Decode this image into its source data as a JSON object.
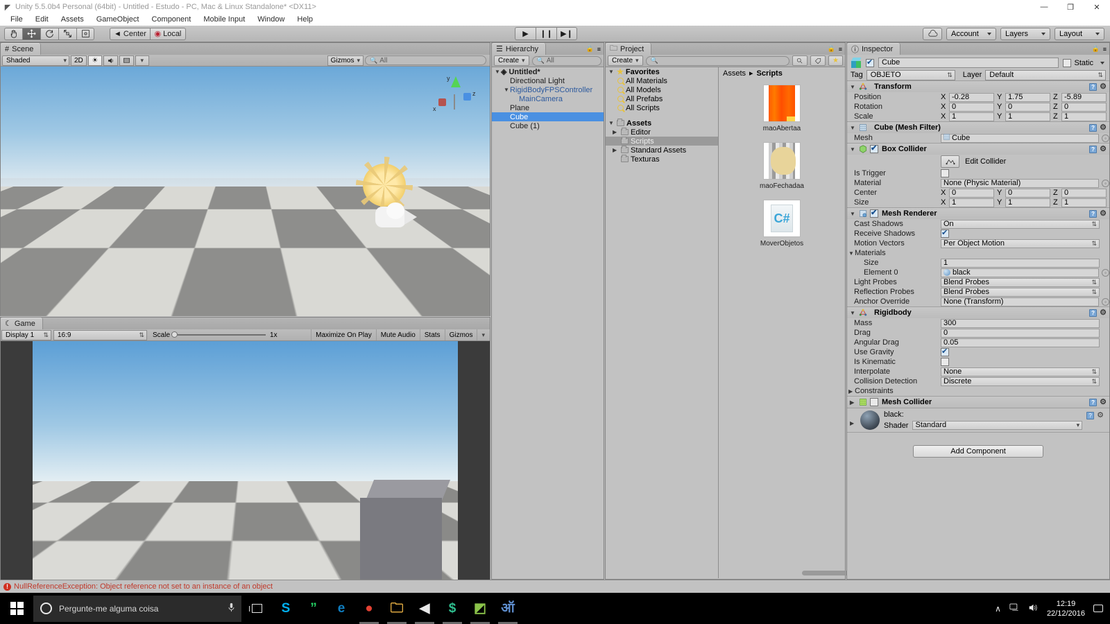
{
  "window": {
    "title": "Unity 5.5.0b4 Personal (64bit) - Untitled - Estudo - PC, Mac & Linux Standalone* <DX11>",
    "minimize": "—",
    "maximize": "❐",
    "close": "✕"
  },
  "menubar": {
    "items": [
      "File",
      "Edit",
      "Assets",
      "GameObject",
      "Component",
      "Mobile Input",
      "Window",
      "Help"
    ]
  },
  "toolbar": {
    "transform_tools": [
      {
        "name": "hand-tool",
        "glyph": "✋"
      },
      {
        "name": "move-tool",
        "glyph": "✛"
      },
      {
        "name": "rotate-tool",
        "glyph": "↻"
      },
      {
        "name": "scale-tool",
        "glyph": "⤡"
      },
      {
        "name": "rect-tool",
        "glyph": "▣"
      }
    ],
    "pivot_label": "Center",
    "rotation_label": "Local",
    "play": "▶",
    "pause": "❙❙",
    "step": "▶❙",
    "cloud": "☁",
    "account_label": "Account",
    "layers_label": "Layers",
    "layout_label": "Layout"
  },
  "scene": {
    "tab_title": "Scene",
    "shading_mode": "Shaded",
    "mode_2d": "2D",
    "lighting_icon": "☀",
    "audio_icon": "🔊",
    "fx_icon": "▣",
    "gizmos_label": "Gizmos",
    "search_placeholder": "All",
    "axis_labels": [
      "y",
      "z",
      "x"
    ]
  },
  "game": {
    "tab_title": "Game",
    "display": "Display 1",
    "aspect": "16:9",
    "scale_label": "Scale",
    "scale_value": "1x",
    "maximize_on_play": "Maximize On Play",
    "mute_audio": "Mute Audio",
    "stats": "Stats",
    "gizmos": "Gizmos"
  },
  "hierarchy": {
    "tab_title": "Hierarchy",
    "create_label": "Create",
    "search_placeholder": "All",
    "scene_name": "Untitled*",
    "items": [
      {
        "label": "Directional Light",
        "depth": 1,
        "expandable": false,
        "selected": false,
        "prefab": false
      },
      {
        "label": "RigidBodyFPSController",
        "depth": 1,
        "expandable": true,
        "selected": false,
        "prefab": true
      },
      {
        "label": "MainCamera",
        "depth": 2,
        "expandable": false,
        "selected": false,
        "prefab": true
      },
      {
        "label": "Plane",
        "depth": 1,
        "expandable": false,
        "selected": false,
        "prefab": false
      },
      {
        "label": "Cube",
        "depth": 1,
        "expandable": false,
        "selected": true,
        "prefab": false
      },
      {
        "label": "Cube (1)",
        "depth": 1,
        "expandable": false,
        "selected": false,
        "prefab": false
      }
    ]
  },
  "project": {
    "tab_title": "Project",
    "create_label": "Create",
    "search_placeholder": "",
    "favorites_label": "Favorites",
    "favorites": [
      "All Materials",
      "All Models",
      "All Prefabs",
      "All Scripts"
    ],
    "assets_label": "Assets",
    "folders": [
      {
        "label": "Editor",
        "expandable": true,
        "selected": false
      },
      {
        "label": "Scripts",
        "expandable": false,
        "selected": true
      },
      {
        "label": "Standard Assets",
        "expandable": true,
        "selected": false
      },
      {
        "label": "Texturas",
        "expandable": false,
        "selected": false
      }
    ],
    "breadcrumb": [
      "Assets",
      "Scripts"
    ],
    "assets": [
      {
        "name": "maoAbertaa",
        "kind": "texture-orange"
      },
      {
        "name": "maoFechadaa",
        "kind": "texture-hand"
      },
      {
        "name": "MoverObjetos",
        "kind": "csharp-script"
      }
    ]
  },
  "inspector": {
    "tab_title": "Inspector",
    "object_name": "Cube",
    "enabled": true,
    "static_label": "Static",
    "static_checked": false,
    "tag_label": "Tag",
    "tag_value": "OBJETO",
    "layer_label": "Layer",
    "layer_value": "Default",
    "components": [
      {
        "name": "Transform",
        "icon": "transform-icon",
        "expanded": true,
        "has_checkbox": false,
        "rows": [
          {
            "type": "vector3",
            "label": "Position",
            "x": "-0.28",
            "y": "1.75",
            "z": "-5.89"
          },
          {
            "type": "vector3",
            "label": "Rotation",
            "x": "0",
            "y": "0",
            "z": "0"
          },
          {
            "type": "vector3",
            "label": "Scale",
            "x": "1",
            "y": "1",
            "z": "1"
          }
        ]
      },
      {
        "name": "Cube (Mesh Filter)",
        "icon": "mesh-filter-icon",
        "expanded": true,
        "has_checkbox": false,
        "rows": [
          {
            "type": "object",
            "label": "Mesh",
            "value": "Cube"
          }
        ]
      },
      {
        "name": "Box Collider",
        "icon": "box-collider-icon",
        "expanded": true,
        "has_checkbox": true,
        "checked": true,
        "rows": [
          {
            "type": "edit-collider",
            "label": "Edit Collider"
          },
          {
            "type": "checkbox",
            "label": "Is Trigger",
            "checked": false
          },
          {
            "type": "object-plain",
            "label": "Material",
            "value": "None (Physic Material)"
          },
          {
            "type": "vector3",
            "label": "Center",
            "x": "0",
            "y": "0",
            "z": "0"
          },
          {
            "type": "vector3",
            "label": "Size",
            "x": "1",
            "y": "1",
            "z": "1"
          }
        ]
      },
      {
        "name": "Mesh Renderer",
        "icon": "mesh-renderer-icon",
        "expanded": true,
        "has_checkbox": true,
        "checked": true,
        "rows": [
          {
            "type": "dropdown",
            "label": "Cast Shadows",
            "value": "On"
          },
          {
            "type": "checkbox",
            "label": "Receive Shadows",
            "checked": true
          },
          {
            "type": "dropdown",
            "label": "Motion Vectors",
            "value": "Per Object Motion"
          },
          {
            "type": "foldout",
            "label": "Materials"
          },
          {
            "type": "text",
            "label": "Size",
            "value": "1",
            "indent": true
          },
          {
            "type": "object-mat",
            "label": "Element 0",
            "value": "black",
            "indent": true
          },
          {
            "type": "dropdown",
            "label": "Light Probes",
            "value": "Blend Probes"
          },
          {
            "type": "dropdown",
            "label": "Reflection Probes",
            "value": "Blend Probes"
          },
          {
            "type": "object-plain",
            "label": "Anchor Override",
            "value": "None (Transform)"
          }
        ]
      },
      {
        "name": "Rigidbody",
        "icon": "rigidbody-icon",
        "expanded": true,
        "has_checkbox": false,
        "rows": [
          {
            "type": "text",
            "label": "Mass",
            "value": "300"
          },
          {
            "type": "text",
            "label": "Drag",
            "value": "0"
          },
          {
            "type": "text",
            "label": "Angular Drag",
            "value": "0.05"
          },
          {
            "type": "checkbox",
            "label": "Use Gravity",
            "checked": true
          },
          {
            "type": "checkbox",
            "label": "Is Kinematic",
            "checked": false
          },
          {
            "type": "dropdown",
            "label": "Interpolate",
            "value": "None"
          },
          {
            "type": "dropdown",
            "label": "Collision Detection",
            "value": "Discrete"
          },
          {
            "type": "foldout-collapsed",
            "label": "Constraints"
          }
        ]
      },
      {
        "name": "Mesh Collider",
        "icon": "mesh-collider-icon",
        "expanded": false,
        "has_checkbox": true,
        "checked": false,
        "rows": []
      }
    ],
    "material": {
      "name": "black:",
      "shader_label": "Shader",
      "shader_value": "Standard"
    },
    "add_component_label": "Add Component"
  },
  "status": {
    "error_icon": "!",
    "message": "NullReferenceException: Object reference not set to an instance of an object"
  },
  "taskbar": {
    "search_placeholder": "Pergunte-me alguma coisa",
    "mic_icon": "🎙",
    "apps": [
      {
        "name": "skype",
        "glyph": "S",
        "color": "#00aff0",
        "running": false
      },
      {
        "name": "whatsapp",
        "glyph": "”",
        "color": "#25d366",
        "running": false
      },
      {
        "name": "edge",
        "glyph": "e",
        "color": "#0f7ec1",
        "running": false
      },
      {
        "name": "chrome",
        "glyph": "●",
        "color": "#e34133",
        "running": true
      },
      {
        "name": "file-explorer",
        "glyph": "🗀",
        "color": "#ffc24b",
        "running": true
      },
      {
        "name": "media-player",
        "glyph": "◀",
        "color": "#e8e8e8",
        "running": true
      },
      {
        "name": "unity-hub",
        "glyph": "$",
        "color": "#2fbf8f",
        "running": true
      },
      {
        "name": "unity-editor",
        "glyph": "◩",
        "color": "#8bc34a",
        "running": true
      },
      {
        "name": "monodevelop",
        "glyph": "ऑ",
        "color": "#5f8fd0",
        "running": true
      }
    ],
    "tray": {
      "chevron": "∧",
      "network": "🖥",
      "volume": "🔊",
      "time": "12:19",
      "date": "22/12/2016",
      "notifications": "▭"
    }
  }
}
